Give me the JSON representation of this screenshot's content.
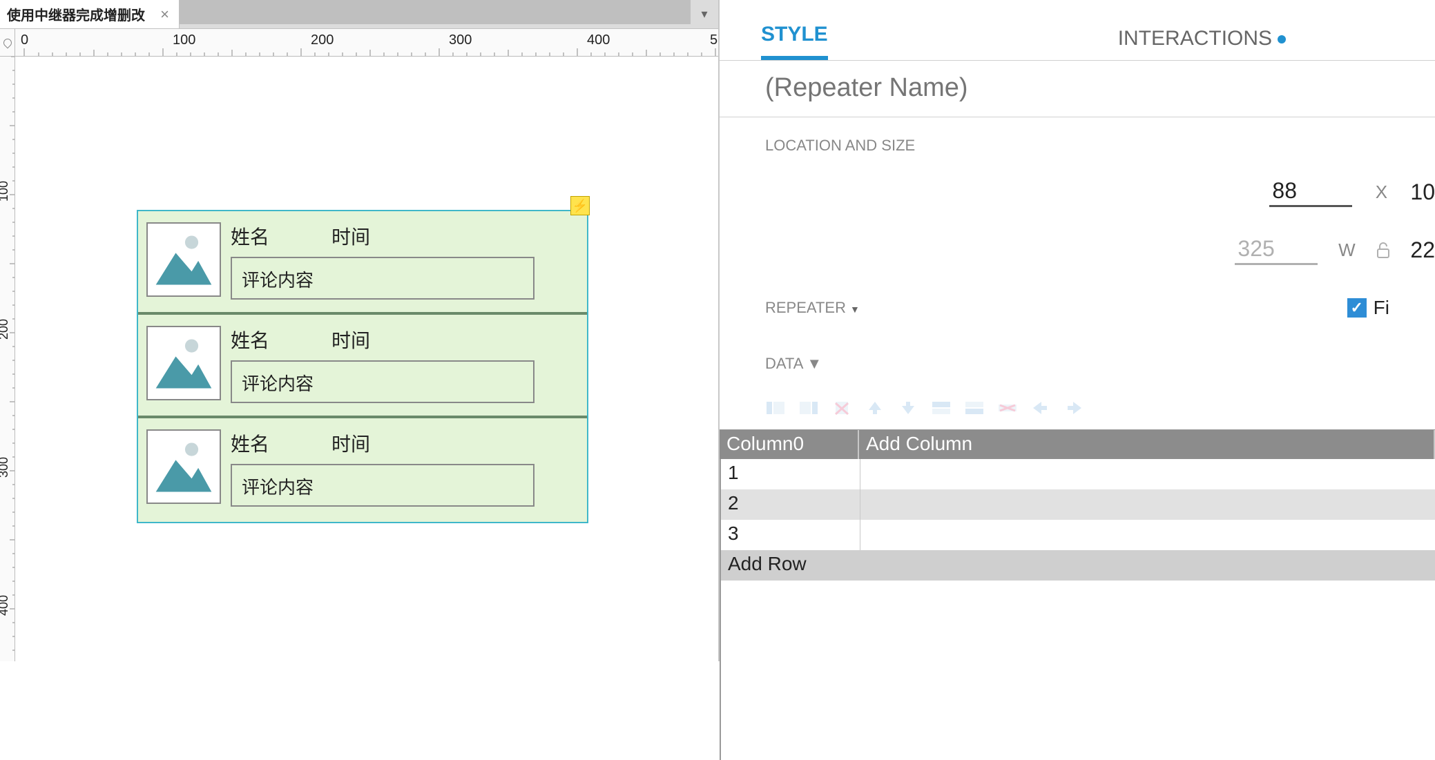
{
  "tab": {
    "title": "使用中继器完成增删改"
  },
  "ruler": {
    "marks": [
      0,
      100,
      200,
      300,
      400
    ],
    "marks_v": [
      100,
      200,
      300,
      400
    ]
  },
  "repeater": {
    "lightning": "⚡",
    "rows": [
      {
        "name_label": "姓名",
        "time_label": "时间",
        "content": "评论内容"
      },
      {
        "name_label": "姓名",
        "time_label": "时间",
        "content": "评论内容"
      },
      {
        "name_label": "姓名",
        "time_label": "时间",
        "content": "评论内容"
      }
    ]
  },
  "inspector": {
    "tabs": {
      "style": "STYLE",
      "interactions": "INTERACTIONS"
    },
    "name_placeholder": "(Repeater Name)",
    "location_size_title": "LOCATION AND SIZE",
    "x_value": "88",
    "x_label": "X",
    "x_cut": "10",
    "w_value": "325",
    "w_label": "W",
    "w_cut": "22",
    "repeater_title": "REPEATER",
    "fit_label": "Fi",
    "data_title": "DATA",
    "table": {
      "col0": "Column0",
      "addcol": "Add Column",
      "rows": [
        "1",
        "2",
        "3"
      ],
      "addrow": "Add Row"
    }
  }
}
